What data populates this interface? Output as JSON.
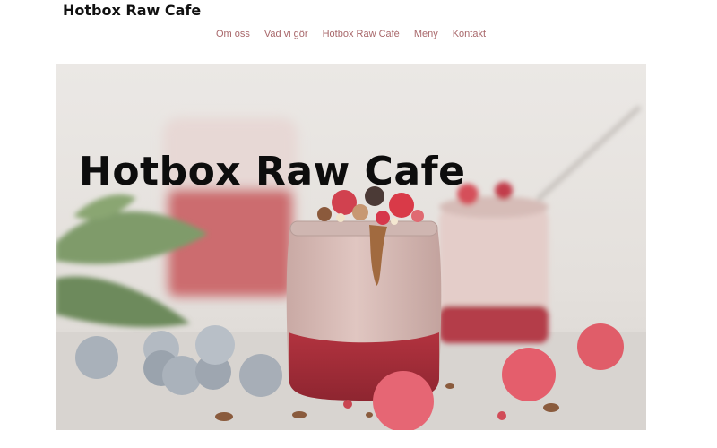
{
  "header": {
    "site_title": "Hotbox Raw Cafe"
  },
  "nav": {
    "items": [
      {
        "label": "Om oss"
      },
      {
        "label": "Vad vi gör"
      },
      {
        "label": "Hotbox Raw Café"
      },
      {
        "label": "Meny"
      },
      {
        "label": "Kontakt"
      }
    ]
  },
  "hero": {
    "title": "Hotbox Raw Cafe"
  },
  "colors": {
    "nav_link": "#a8676a",
    "title": "#111111",
    "hero_background": "#e9e6e3",
    "berry_red": "#d2454f",
    "chia_pink": "#d9b9b5"
  }
}
